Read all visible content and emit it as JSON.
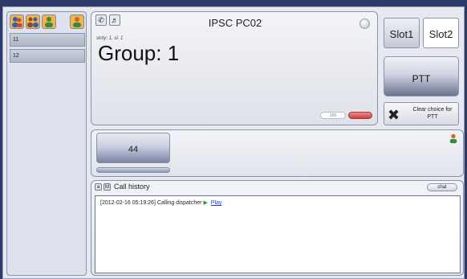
{
  "left_panel": {
    "tools": [
      {
        "icon": "user-group-icon"
      },
      {
        "icon": "users-icon"
      },
      {
        "icon": "user-icon"
      },
      {
        "icon": "user-settings-icon"
      }
    ],
    "items": [
      {
        "label": "11"
      },
      {
        "label": "12"
      }
    ]
  },
  "group_panel": {
    "tool_icons": [
      "phone-icon",
      "speaker-icon"
    ],
    "title": "IPSC PC02",
    "subtitle": "sloty: 1, sl. 1",
    "group_label": "Group: 1",
    "pill_label": "165"
  },
  "controls": {
    "slot1_label": "Slot1",
    "slot2_label": "Slot2",
    "ptt_label": "PTT",
    "clear_label": "Clear choice for PTT"
  },
  "talkgroup": {
    "button_label": "44",
    "icon": "user-icon"
  },
  "call_history": {
    "btn1": "a",
    "btn2": "M",
    "title": "Call history",
    "chat_label": "chat",
    "entries": [
      {
        "text": "[2012-02-16 05:19:26] Calling dispatcher",
        "link": "Play"
      }
    ]
  },
  "colors": {
    "window_bg": "#e6e9f0",
    "desktop_bg": "#2b3a6b",
    "accent_icon": "#f4b24a",
    "link": "#1a3bd6",
    "play_arrow": "#2e9a2e"
  }
}
